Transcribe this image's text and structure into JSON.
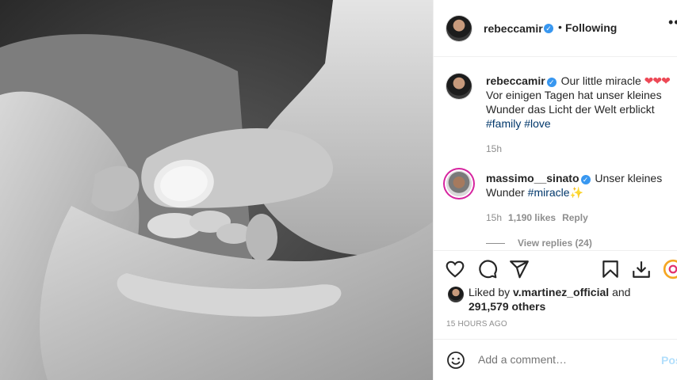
{
  "post": {
    "username": "rebeccamir",
    "follow_label": "Following",
    "dot": "•",
    "more": "•••"
  },
  "caption": {
    "username": "rebeccamir",
    "text_first": "Our little miracle",
    "hearts": "❤❤❤",
    "text_rest": "Vor einigen Tagen hat unser kleines Wunder das Licht der Welt erblickt",
    "tag1": "#family",
    "tag2": "#love",
    "time": "15h"
  },
  "comment": {
    "username": "massimo__sinato",
    "text": "Unser kleines Wunder",
    "tag": "#miracle",
    "sparkle": "✨",
    "time": "15h",
    "likes": "1,190 likes",
    "reply": "Reply",
    "view_replies": "View replies (24)"
  },
  "likes": {
    "prefix": "Liked by",
    "user": "v.martinez_official",
    "conj": "and",
    "others": "291,579 others"
  },
  "timestamp": "15 HOURS AGO",
  "add_comment": {
    "placeholder": "Add a comment…",
    "post_label": "Post"
  },
  "icons": {
    "like": "heart-icon",
    "comment": "comment-icon",
    "share": "share-icon",
    "save": "bookmark-icon",
    "download": "download-icon",
    "extension": "instagram-logo-icon",
    "emoji": "emoji-icon"
  },
  "colors": {
    "verified": "#3897f0",
    "hashtag": "#00376b",
    "heart": "#ed4956",
    "muted": "#8e8e8e",
    "post_disabled": "#b2dffc"
  }
}
